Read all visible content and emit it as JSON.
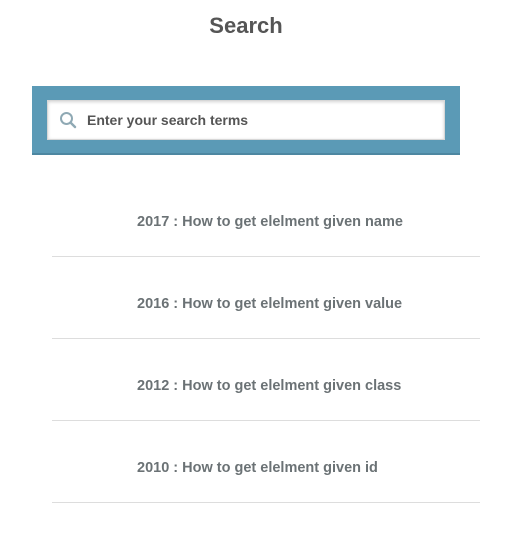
{
  "header": {
    "title": "Search"
  },
  "search": {
    "placeholder": "Enter your search terms",
    "value": "",
    "icon": "search-icon"
  },
  "results": [
    {
      "label": "2017 : How to get elelment given name"
    },
    {
      "label": "2016 : How to get elelment given value"
    },
    {
      "label": "2012 : How to get elelment given class"
    },
    {
      "label": "2010 : How to get elelment given id"
    }
  ],
  "colors": {
    "search_band": "#5b9ab6",
    "title_text": "#555555",
    "result_text": "#6b7275",
    "divider": "#dddddd"
  }
}
